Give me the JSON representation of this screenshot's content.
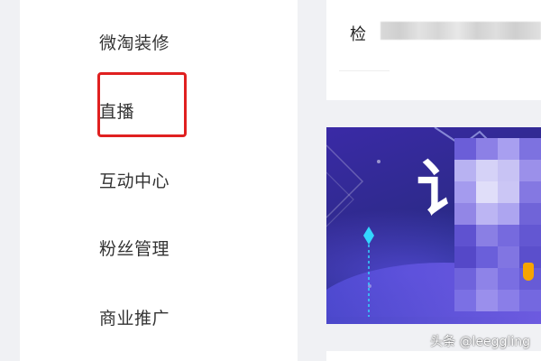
{
  "sidebar": {
    "items": [
      {
        "label": "微淘装修"
      },
      {
        "label": "直播"
      },
      {
        "label": "互动中心"
      },
      {
        "label": "粉丝管理"
      },
      {
        "label": "商业推广"
      }
    ],
    "highlighted_item": "直播",
    "highlight_color": "#e02020"
  },
  "main": {
    "search_label": "检",
    "banner": {
      "visible_glyph": "讠",
      "colors": {
        "primary": "#3a2aa6",
        "accent": "#7f64f0",
        "cyan": "#33d6ff",
        "orange": "#f7a400"
      }
    }
  },
  "watermark": {
    "text": "头条 @leeggling"
  }
}
